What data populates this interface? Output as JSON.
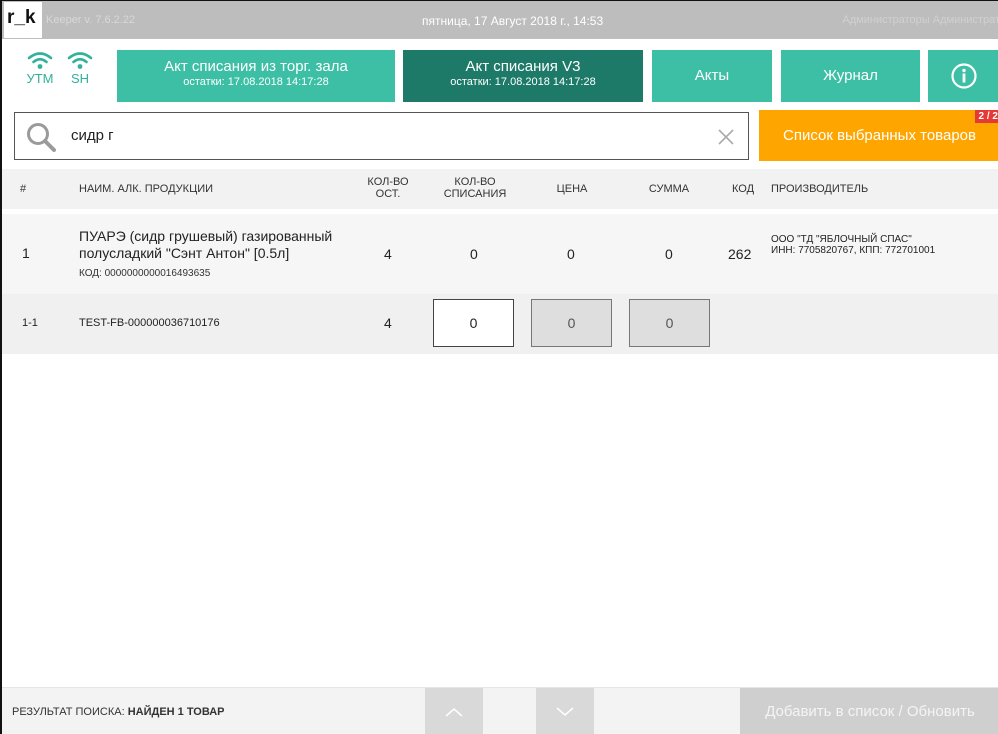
{
  "titlebar": {
    "logo": "r_k",
    "version": "Keeper v. 7.6.2.22",
    "datetime": "пятница, 17 Август 2018 г., 14:53",
    "user": "Администраторы Администрат"
  },
  "status": {
    "utm_label": "УТМ",
    "sh_label": "SH"
  },
  "header": {
    "act_trade": {
      "title": "Акт списания из торг. зала",
      "subtitle": "остатки: 17.08.2018 14:17:28"
    },
    "act_v3": {
      "title": "Акт списания V3",
      "subtitle": "остатки: 17.08.2018 14:17:28"
    },
    "acts_label": "Акты",
    "journal_label": "Журнал"
  },
  "search": {
    "value": "сидр г",
    "selected_list_label": "Список выбранных товаров",
    "badge": "2 / 2"
  },
  "table": {
    "headers": {
      "num": "#",
      "name": "НАИМ. АЛК. ПРОДУКЦИИ",
      "qty_left": "КОЛ-ВО ОСТ.",
      "qty_write_off": "КОЛ-ВО СПИСАНИЯ",
      "price": "ЦЕНА",
      "sum": "СУММА",
      "code": "КОД",
      "producer": "ПРОИЗВОДИТЕЛЬ"
    },
    "row1": {
      "num": "1",
      "name": "ПУАРЭ (сидр грушевый) газированный полусладкий \"Сэнт Антон\"  [0.5л]",
      "code_line": "КОД: 0000000000016493635",
      "qty_left": "4",
      "qty_write_off": "0",
      "price": "0",
      "sum": "0",
      "code": "262",
      "producer_name": "ООО \"ТД \"ЯБЛОЧНЫЙ СПАС\"",
      "producer_ids": "ИНН: 7705820767, КПП: 772701001"
    },
    "row2": {
      "num": "1-1",
      "barcode": "TEST-FB-000000036710176",
      "qty_left": "4",
      "qty_write_off": "0",
      "price": "0",
      "sum": "0"
    }
  },
  "footer": {
    "result_prefix": "РЕЗУЛЬТАТ ПОИСКА: ",
    "result_value": "НАЙДЕН 1 ТОВАР",
    "add_label": "Добавить в список / Обновить"
  },
  "colors": {
    "accent": "#3dbfa5",
    "accent_dark": "#1e7a68",
    "orange": "#ffa500",
    "badge_red": "#e53935"
  }
}
